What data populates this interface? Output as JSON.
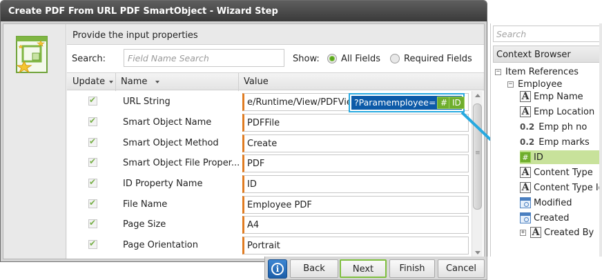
{
  "dialog": {
    "title": "Create PDF From URL PDF SmartObject - Wizard Step",
    "section_title": "Provide the input properties",
    "search_label": "Search:",
    "search_placeholder": "Field Name Search",
    "show_label": "Show:",
    "filter_all": "All Fields",
    "filter_required": "Required Fields",
    "filter_selected": "All Fields",
    "columns": {
      "update": "Update",
      "name": "Name",
      "value": "Value"
    },
    "rows": [
      {
        "name": "URL String",
        "value": "e/Runtime/View/PDFView",
        "checked": true
      },
      {
        "name": "Smart Object Name",
        "value": "PDFFile",
        "checked": true
      },
      {
        "name": "Smart Object Method",
        "value": "Create",
        "checked": true
      },
      {
        "name": "Smart Object File Proper...",
        "value": "PDF",
        "checked": true
      },
      {
        "name": "ID Property Name",
        "value": "ID",
        "checked": true
      },
      {
        "name": "File Name",
        "value": "Employee PDF",
        "checked": true
      },
      {
        "name": "Page Size",
        "value": "A4",
        "checked": true
      },
      {
        "name": "Page Orientation",
        "value": "Portrait",
        "checked": true
      }
    ],
    "url_chip": {
      "text": "?Paramemployee=",
      "hash": "#",
      "field": "ID"
    },
    "buttons": {
      "back": "Back",
      "next": "Next",
      "finish": "Finish",
      "cancel": "Cancel",
      "info": "i"
    }
  },
  "context_browser": {
    "search_placeholder": "Search",
    "title": "Context Browser",
    "root": "Item References",
    "object": "Employee",
    "items": [
      {
        "label": "Emp Name",
        "icon": "text-icon",
        "glyph": "A"
      },
      {
        "label": "Emp Location",
        "icon": "text-icon",
        "glyph": "A"
      },
      {
        "label": "Emp ph no",
        "icon": "decimal-icon",
        "glyph": "0.2"
      },
      {
        "label": "Emp marks",
        "icon": "decimal-icon",
        "glyph": "0.2"
      },
      {
        "label": "ID",
        "icon": "autonumber-icon",
        "glyph": "#",
        "selected": true
      },
      {
        "label": "Content Type",
        "icon": "text-icon",
        "glyph": "A"
      },
      {
        "label": "Content Type Id",
        "icon": "text-icon",
        "glyph": "A"
      },
      {
        "label": "Modified",
        "icon": "datetime-icon"
      },
      {
        "label": "Created",
        "icon": "datetime-icon"
      },
      {
        "label": "Created By",
        "icon": "text-icon",
        "glyph": "A"
      }
    ],
    "expand_glyph": "+",
    "collapse_glyph": "−"
  },
  "colors": {
    "accent_green": "#6fae2c",
    "highlight_blue": "#27a9e0",
    "selection_blue": "#0c5aa8",
    "required_marker": "#e07c22"
  }
}
